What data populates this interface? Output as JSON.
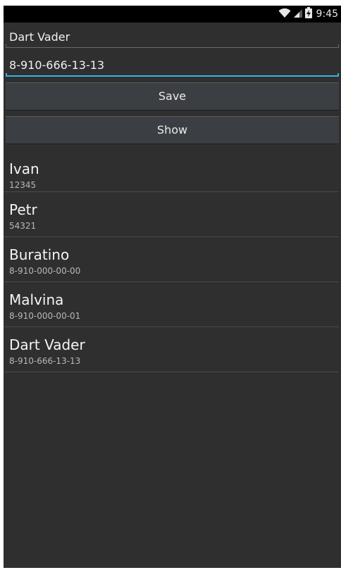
{
  "status_bar": {
    "time": "9:45",
    "icons": [
      "wifi-icon",
      "signal-icon",
      "battery-charging-icon"
    ]
  },
  "form": {
    "name_value": "Dart Vader",
    "phone_value": "8-910-666-13-13"
  },
  "buttons": {
    "save_label": "Save",
    "show_label": "Show"
  },
  "contacts": [
    {
      "name": "Ivan",
      "phone": "12345"
    },
    {
      "name": "Petr",
      "phone": "54321"
    },
    {
      "name": "Buratino",
      "phone": "8-910-000-00-00"
    },
    {
      "name": "Malvina",
      "phone": "8-910-000-00-01"
    },
    {
      "name": "Dart Vader",
      "phone": "8-910-666-13-13"
    }
  ],
  "colors": {
    "background": "#2f2f2f",
    "accent": "#33b5e5",
    "button": "#3b3e42"
  }
}
